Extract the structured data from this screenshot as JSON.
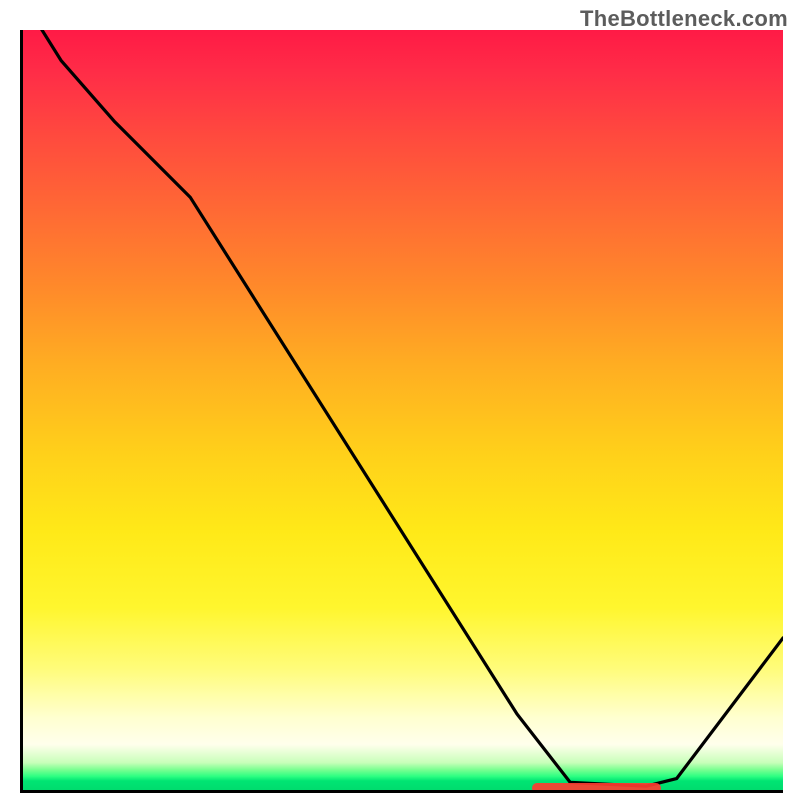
{
  "watermark": "TheBottleneck.com",
  "colors": {
    "axis": "#000000",
    "curve": "#000000",
    "gradient_top": "#ff1a46",
    "gradient_mid": "#ffe516",
    "gradient_bottom": "#00dc6e",
    "marker": "#ff3b30"
  },
  "chart_data": {
    "type": "line",
    "title": "",
    "xlabel": "",
    "ylabel": "",
    "xlim": [
      0,
      100
    ],
    "ylim": [
      0,
      100
    ],
    "background": "red-yellow-green vertical gradient (bottleneck heatmap)",
    "x": [
      0,
      5,
      12,
      22,
      65,
      72,
      82,
      86,
      100
    ],
    "y": [
      104,
      96,
      88,
      78,
      10,
      1,
      0.5,
      1.5,
      20
    ],
    "marker_range_x": [
      67,
      84
    ],
    "marker_y": 0.3,
    "notes": "Values estimated from pixels; axes carry no tick labels so x,y are in percent of axis length. Curve descends steeply, bottoms out near x≈72–82, then rises. Red horizontal marker sits on the valley floor."
  }
}
